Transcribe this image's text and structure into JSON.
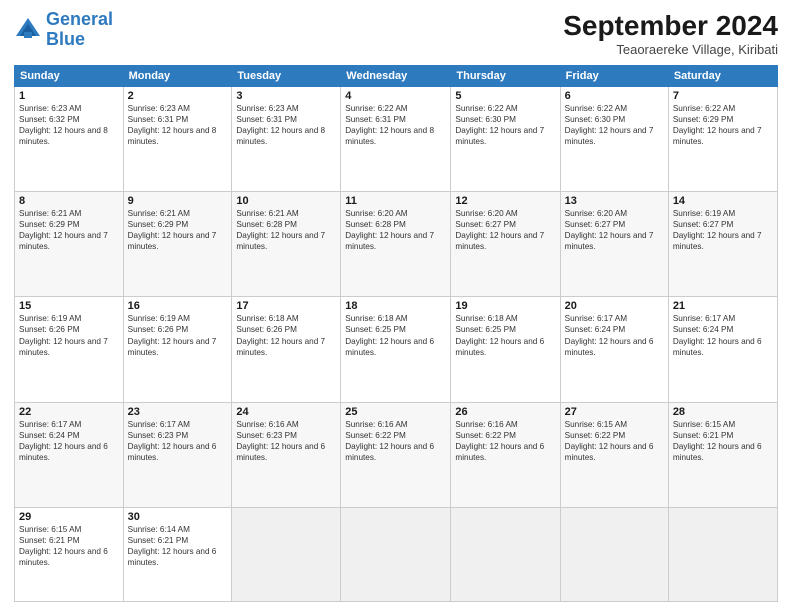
{
  "header": {
    "logo_line1": "General",
    "logo_line2": "Blue",
    "month": "September 2024",
    "location": "Teaoraereke Village, Kiribati"
  },
  "weekdays": [
    "Sunday",
    "Monday",
    "Tuesday",
    "Wednesday",
    "Thursday",
    "Friday",
    "Saturday"
  ],
  "weeks": [
    [
      {
        "day": "1",
        "sunrise": "Sunrise: 6:23 AM",
        "sunset": "Sunset: 6:32 PM",
        "daylight": "Daylight: 12 hours and 8 minutes."
      },
      {
        "day": "2",
        "sunrise": "Sunrise: 6:23 AM",
        "sunset": "Sunset: 6:31 PM",
        "daylight": "Daylight: 12 hours and 8 minutes."
      },
      {
        "day": "3",
        "sunrise": "Sunrise: 6:23 AM",
        "sunset": "Sunset: 6:31 PM",
        "daylight": "Daylight: 12 hours and 8 minutes."
      },
      {
        "day": "4",
        "sunrise": "Sunrise: 6:22 AM",
        "sunset": "Sunset: 6:31 PM",
        "daylight": "Daylight: 12 hours and 8 minutes."
      },
      {
        "day": "5",
        "sunrise": "Sunrise: 6:22 AM",
        "sunset": "Sunset: 6:30 PM",
        "daylight": "Daylight: 12 hours and 7 minutes."
      },
      {
        "day": "6",
        "sunrise": "Sunrise: 6:22 AM",
        "sunset": "Sunset: 6:30 PM",
        "daylight": "Daylight: 12 hours and 7 minutes."
      },
      {
        "day": "7",
        "sunrise": "Sunrise: 6:22 AM",
        "sunset": "Sunset: 6:29 PM",
        "daylight": "Daylight: 12 hours and 7 minutes."
      }
    ],
    [
      {
        "day": "8",
        "sunrise": "Sunrise: 6:21 AM",
        "sunset": "Sunset: 6:29 PM",
        "daylight": "Daylight: 12 hours and 7 minutes."
      },
      {
        "day": "9",
        "sunrise": "Sunrise: 6:21 AM",
        "sunset": "Sunset: 6:29 PM",
        "daylight": "Daylight: 12 hours and 7 minutes."
      },
      {
        "day": "10",
        "sunrise": "Sunrise: 6:21 AM",
        "sunset": "Sunset: 6:28 PM",
        "daylight": "Daylight: 12 hours and 7 minutes."
      },
      {
        "day": "11",
        "sunrise": "Sunrise: 6:20 AM",
        "sunset": "Sunset: 6:28 PM",
        "daylight": "Daylight: 12 hours and 7 minutes."
      },
      {
        "day": "12",
        "sunrise": "Sunrise: 6:20 AM",
        "sunset": "Sunset: 6:27 PM",
        "daylight": "Daylight: 12 hours and 7 minutes."
      },
      {
        "day": "13",
        "sunrise": "Sunrise: 6:20 AM",
        "sunset": "Sunset: 6:27 PM",
        "daylight": "Daylight: 12 hours and 7 minutes."
      },
      {
        "day": "14",
        "sunrise": "Sunrise: 6:19 AM",
        "sunset": "Sunset: 6:27 PM",
        "daylight": "Daylight: 12 hours and 7 minutes."
      }
    ],
    [
      {
        "day": "15",
        "sunrise": "Sunrise: 6:19 AM",
        "sunset": "Sunset: 6:26 PM",
        "daylight": "Daylight: 12 hours and 7 minutes."
      },
      {
        "day": "16",
        "sunrise": "Sunrise: 6:19 AM",
        "sunset": "Sunset: 6:26 PM",
        "daylight": "Daylight: 12 hours and 7 minutes."
      },
      {
        "day": "17",
        "sunrise": "Sunrise: 6:18 AM",
        "sunset": "Sunset: 6:26 PM",
        "daylight": "Daylight: 12 hours and 7 minutes."
      },
      {
        "day": "18",
        "sunrise": "Sunrise: 6:18 AM",
        "sunset": "Sunset: 6:25 PM",
        "daylight": "Daylight: 12 hours and 6 minutes."
      },
      {
        "day": "19",
        "sunrise": "Sunrise: 6:18 AM",
        "sunset": "Sunset: 6:25 PM",
        "daylight": "Daylight: 12 hours and 6 minutes."
      },
      {
        "day": "20",
        "sunrise": "Sunrise: 6:17 AM",
        "sunset": "Sunset: 6:24 PM",
        "daylight": "Daylight: 12 hours and 6 minutes."
      },
      {
        "day": "21",
        "sunrise": "Sunrise: 6:17 AM",
        "sunset": "Sunset: 6:24 PM",
        "daylight": "Daylight: 12 hours and 6 minutes."
      }
    ],
    [
      {
        "day": "22",
        "sunrise": "Sunrise: 6:17 AM",
        "sunset": "Sunset: 6:24 PM",
        "daylight": "Daylight: 12 hours and 6 minutes."
      },
      {
        "day": "23",
        "sunrise": "Sunrise: 6:17 AM",
        "sunset": "Sunset: 6:23 PM",
        "daylight": "Daylight: 12 hours and 6 minutes."
      },
      {
        "day": "24",
        "sunrise": "Sunrise: 6:16 AM",
        "sunset": "Sunset: 6:23 PM",
        "daylight": "Daylight: 12 hours and 6 minutes."
      },
      {
        "day": "25",
        "sunrise": "Sunrise: 6:16 AM",
        "sunset": "Sunset: 6:22 PM",
        "daylight": "Daylight: 12 hours and 6 minutes."
      },
      {
        "day": "26",
        "sunrise": "Sunrise: 6:16 AM",
        "sunset": "Sunset: 6:22 PM",
        "daylight": "Daylight: 12 hours and 6 minutes."
      },
      {
        "day": "27",
        "sunrise": "Sunrise: 6:15 AM",
        "sunset": "Sunset: 6:22 PM",
        "daylight": "Daylight: 12 hours and 6 minutes."
      },
      {
        "day": "28",
        "sunrise": "Sunrise: 6:15 AM",
        "sunset": "Sunset: 6:21 PM",
        "daylight": "Daylight: 12 hours and 6 minutes."
      }
    ],
    [
      {
        "day": "29",
        "sunrise": "Sunrise: 6:15 AM",
        "sunset": "Sunset: 6:21 PM",
        "daylight": "Daylight: 12 hours and 6 minutes."
      },
      {
        "day": "30",
        "sunrise": "Sunrise: 6:14 AM",
        "sunset": "Sunset: 6:21 PM",
        "daylight": "Daylight: 12 hours and 6 minutes."
      },
      null,
      null,
      null,
      null,
      null
    ]
  ]
}
